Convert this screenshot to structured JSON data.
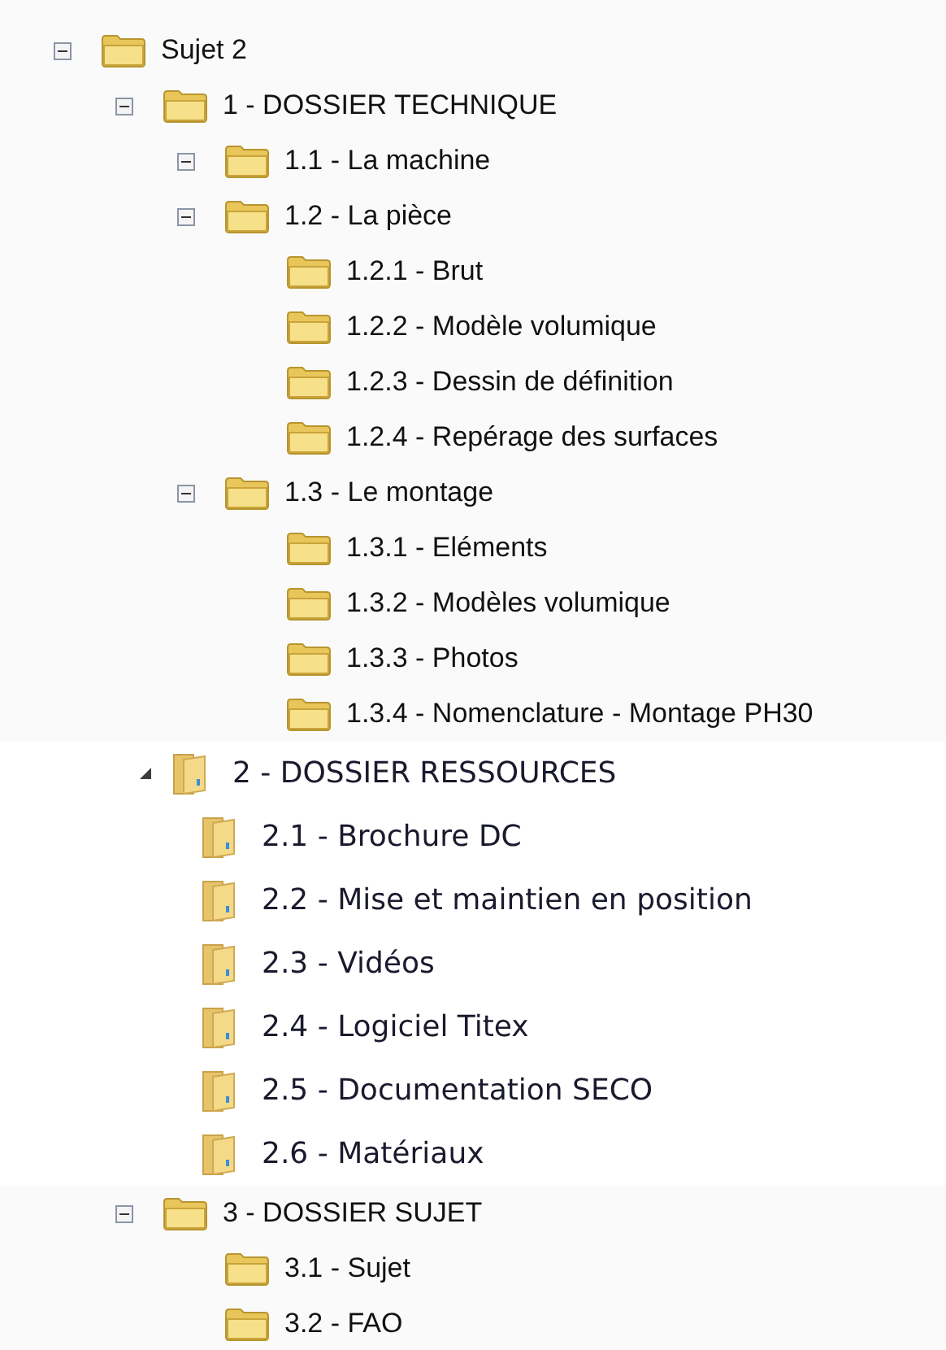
{
  "tree": [
    {
      "kind": "classic",
      "label": "Sujet 2",
      "expanded": true,
      "children": [
        {
          "kind": "classic",
          "label": "1 - DOSSIER TECHNIQUE",
          "expanded": true,
          "children": [
            {
              "kind": "classic",
              "label": "1.1 - La machine",
              "expanded": true
            },
            {
              "kind": "classic",
              "label": "1.2 - La pièce",
              "expanded": true,
              "children": [
                {
                  "kind": "classic",
                  "label": "1.2.1 - Brut"
                },
                {
                  "kind": "classic",
                  "label": "1.2.2 - Modèle volumique"
                },
                {
                  "kind": "classic",
                  "label": "1.2.3 - Dessin de définition"
                },
                {
                  "kind": "classic",
                  "label": "1.2.4 - Repérage des surfaces"
                }
              ]
            },
            {
              "kind": "classic",
              "label": "1.3 - Le montage",
              "expanded": true,
              "children": [
                {
                  "kind": "classic",
                  "label": "1.3.1 - Eléments"
                },
                {
                  "kind": "classic",
                  "label": "1.3.2 - Modèles volumique"
                },
                {
                  "kind": "classic",
                  "label": "1.3.3 - Photos"
                },
                {
                  "kind": "classic",
                  "label": "1.3.4 - Nomenclature - Montage PH30"
                }
              ]
            }
          ]
        },
        {
          "kind": "modern",
          "label": "2 - DOSSIER RESSOURCES",
          "expanded": true,
          "children": [
            {
              "kind": "modern",
              "label": "2.1 - Brochure DC"
            },
            {
              "kind": "modern",
              "label": "2.2 - Mise et maintien en position"
            },
            {
              "kind": "modern",
              "label": "2.3 - Vidéos"
            },
            {
              "kind": "modern",
              "label": "2.4 - Logiciel Titex"
            },
            {
              "kind": "modern",
              "label": "2.5 - Documentation SECO"
            },
            {
              "kind": "modern",
              "label": "2.6 - Matériaux"
            }
          ]
        },
        {
          "kind": "classic",
          "label": "3 - DOSSIER SUJET",
          "expanded": true,
          "children": [
            {
              "kind": "classic",
              "label": "3.1 - Sujet"
            },
            {
              "kind": "classic",
              "label": "3.2 - FAO"
            }
          ]
        }
      ]
    }
  ]
}
